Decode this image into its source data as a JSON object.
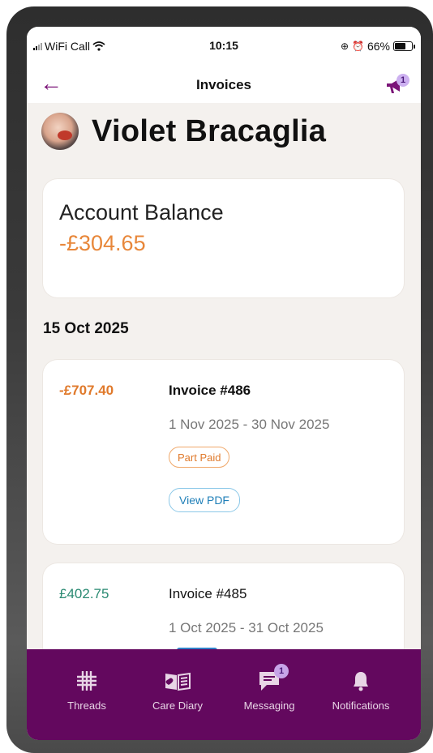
{
  "status_bar": {
    "carrier": "WiFi Call",
    "time": "10:15",
    "battery": "66%"
  },
  "nav": {
    "title": "Invoices",
    "back_icon": "back-arrow-icon",
    "notice_icon": "megaphone-icon",
    "notice_badge": "1"
  },
  "child": {
    "name": "Violet Bracaglia"
  },
  "balance": {
    "label": "Account Balance",
    "value": "-£304.65"
  },
  "date_group": "15 Oct 2025",
  "invoices": [
    {
      "amount": "-£707.40",
      "title": "Invoice #486",
      "period": "1 Nov 2025 - 30 Nov 2025",
      "status": "Part Paid",
      "pdf_label": "View PDF"
    },
    {
      "amount": "£402.75",
      "title": "Invoice #485",
      "period": "1 Oct 2025 - 31 Oct 2025"
    }
  ],
  "tabs": [
    {
      "label": "Threads",
      "icon": "threads-grid-icon"
    },
    {
      "label": "Care Diary",
      "icon": "care-diary-icon"
    },
    {
      "label": "Messaging",
      "icon": "messaging-icon",
      "badge": "1"
    },
    {
      "label": "Notifications",
      "icon": "bell-icon"
    }
  ],
  "colors": {
    "accent": "#7b1478",
    "tabbar": "#63085e",
    "negative_amount": "#e07a2c",
    "positive_amount": "#2a8a72"
  }
}
